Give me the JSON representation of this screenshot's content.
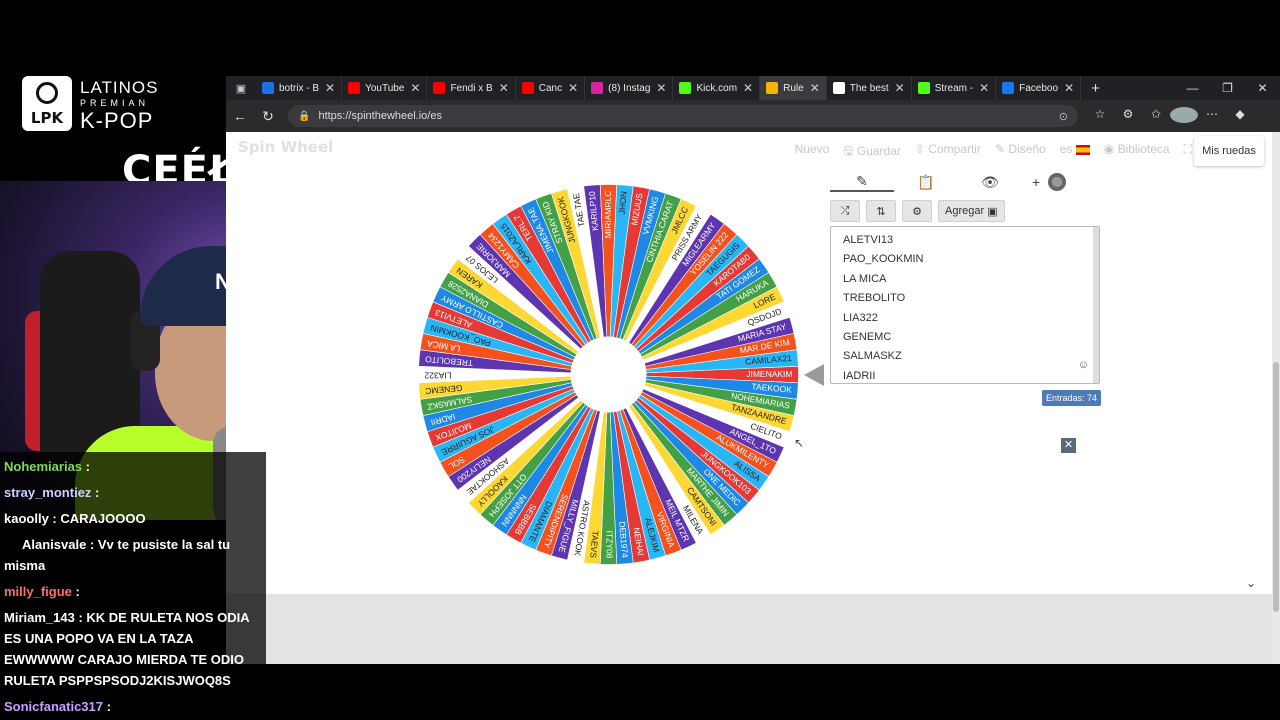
{
  "overlay": {
    "logo_text": "LPK",
    "brand_line1": "LATINOS",
    "brand_line2": "PREMIAN",
    "brand_line3": "K-POP",
    "streamer_tag": "CEÉŁ",
    "cap_logo": "NY"
  },
  "chat": [
    {
      "user": "Nohemiarias",
      "sep": " : ",
      "text": "",
      "color": "#7ed957"
    },
    {
      "user": "stray_montiez",
      "sep": " : ",
      "text": "",
      "color": "#d0d0ff"
    },
    {
      "user": "kaoolly",
      "sep": " : ",
      "text": "CARAJOOOO",
      "color": "#ffffff"
    },
    {
      "user": "Alanisvale",
      "sep": " : ",
      "text": "Vv te pusiste la sal tu",
      "color": "#ffffff"
    },
    {
      "user": "",
      "sep": "",
      "text": "misma",
      "color": "#ffffff"
    },
    {
      "user": "milly_figue",
      "sep": " : ",
      "text": "",
      "color": "#ff6b6b"
    },
    {
      "user": "Miriam_143",
      "sep": " : ",
      "text": "KK DE RULETA NOS ODIA",
      "color": "#ffffff"
    },
    {
      "user": "",
      "sep": "",
      "text": "ES UNA POPO VA EN LA TAZA",
      "color": "#ffffff"
    },
    {
      "user": "",
      "sep": "",
      "text": "EWWWWW CARAJO MIERDA TE ODIO",
      "color": "#ffffff"
    },
    {
      "user": "",
      "sep": "",
      "text": "RULETA PSPPSPSODJ2KISJWOQ8S",
      "color": "#ffffff"
    },
    {
      "user": "Sonicfanatic317",
      "sep": " : ",
      "text": "",
      "color": "#c8a0ff"
    }
  ],
  "browser": {
    "tabs": [
      {
        "label": "botrix - B",
        "color": "#1a73e8"
      },
      {
        "label": "YouTube",
        "color": "#ff0000"
      },
      {
        "label": "Fendi x B",
        "color": "#ff0000"
      },
      {
        "label": "Canc",
        "color": "#ff0000"
      },
      {
        "label": "(8) Instag",
        "color": "#d6249f"
      },
      {
        "label": "Kick.com",
        "color": "#53fc18"
      },
      {
        "label": "Rule",
        "color": "#f4b400"
      },
      {
        "label": "The best",
        "color": "#ffffff"
      },
      {
        "label": "Stream -",
        "color": "#53fc18"
      },
      {
        "label": "Faceboo",
        "color": "#1877f2"
      }
    ],
    "url": "https://spinthewheel.io/es"
  },
  "site": {
    "logo": "Spin Wheel",
    "nav": [
      "Nuevo",
      "Guardar",
      "Compartir",
      "Diseño",
      "es",
      "Biblioteca"
    ],
    "my_wheels": "Mis ruedas",
    "add_label": "Agregar",
    "entries_visible": [
      "ALETVI13",
      "PAO_KOOKMIN",
      "LA MICA",
      "TREBOLITO",
      "LIA322",
      "GENEMC",
      "SALMASKZ",
      "IADRII"
    ],
    "entries_count_label": "Entradas: 74"
  },
  "wheel": {
    "colors": [
      "#e53935",
      "#1e88e5",
      "#43a047",
      "#fdd835",
      "#ffffff",
      "#5e35b1",
      "#f4511e",
      "#29b6f6"
    ],
    "segments": [
      "JIMENAKIM",
      "TAEKOOK",
      "NOHEMIARIAS",
      "TANZAANDRE",
      "CIELITO",
      "ANGEL_1TO",
      "ALUKMILENTY",
      "ALISSA",
      "JUNGKOOK103",
      "ONE MEDIC",
      "MARTHE JIMIN",
      "CAMTSONI",
      "MILENA",
      "MEIL MTZR",
      "VIRGINIA",
      "ALEJKIM",
      "NEIHAI",
      "DEB1974",
      "ITZY08",
      "TAEVS",
      "ASTRO.KOOK",
      "MILLY_FIGUE",
      "SERENDIPITY",
      "DIAMANTE",
      "SEBBBB",
      "NNNNNN",
      "OTT JOSEPH",
      "KAOOLLY",
      "ASHOOKTAE",
      "NELIY200",
      "SOL",
      "JOS AGUIRRE",
      "MOJITOX",
      "IADRII",
      "SALMASKZ",
      "GENEMC",
      "LIA322",
      "TREBOLITO",
      "LA MICA",
      "PAO_KOOKMIN",
      "ALETVI13",
      "CASTILLO ARMY",
      "DIANA2528",
      "KAREN",
      "LEJOS 07",
      "MARJORIE",
      "CAMY1234",
      "KARLAZ015",
      "TERL.7",
      "JIMENA.TAE",
      "STRAY KID",
      "JUNGKOOK",
      "TAE TAE",
      "KARILP10",
      "MIRIAMRLC",
      "JHON",
      "MIZUUS",
      "VVMKING",
      "CINTHIA.CARAT",
      "JMLCC",
      "PRISS ARMY",
      "MIGLEARMY",
      "YOSELIN 222",
      "TAEGUGIS",
      "KAROTAB0",
      "TATI GOMEZ",
      "HARUKA",
      "LORE",
      "QSDOJD",
      "MARIA STAY",
      "MAR DE KIM",
      "CAMILAX21"
    ]
  }
}
